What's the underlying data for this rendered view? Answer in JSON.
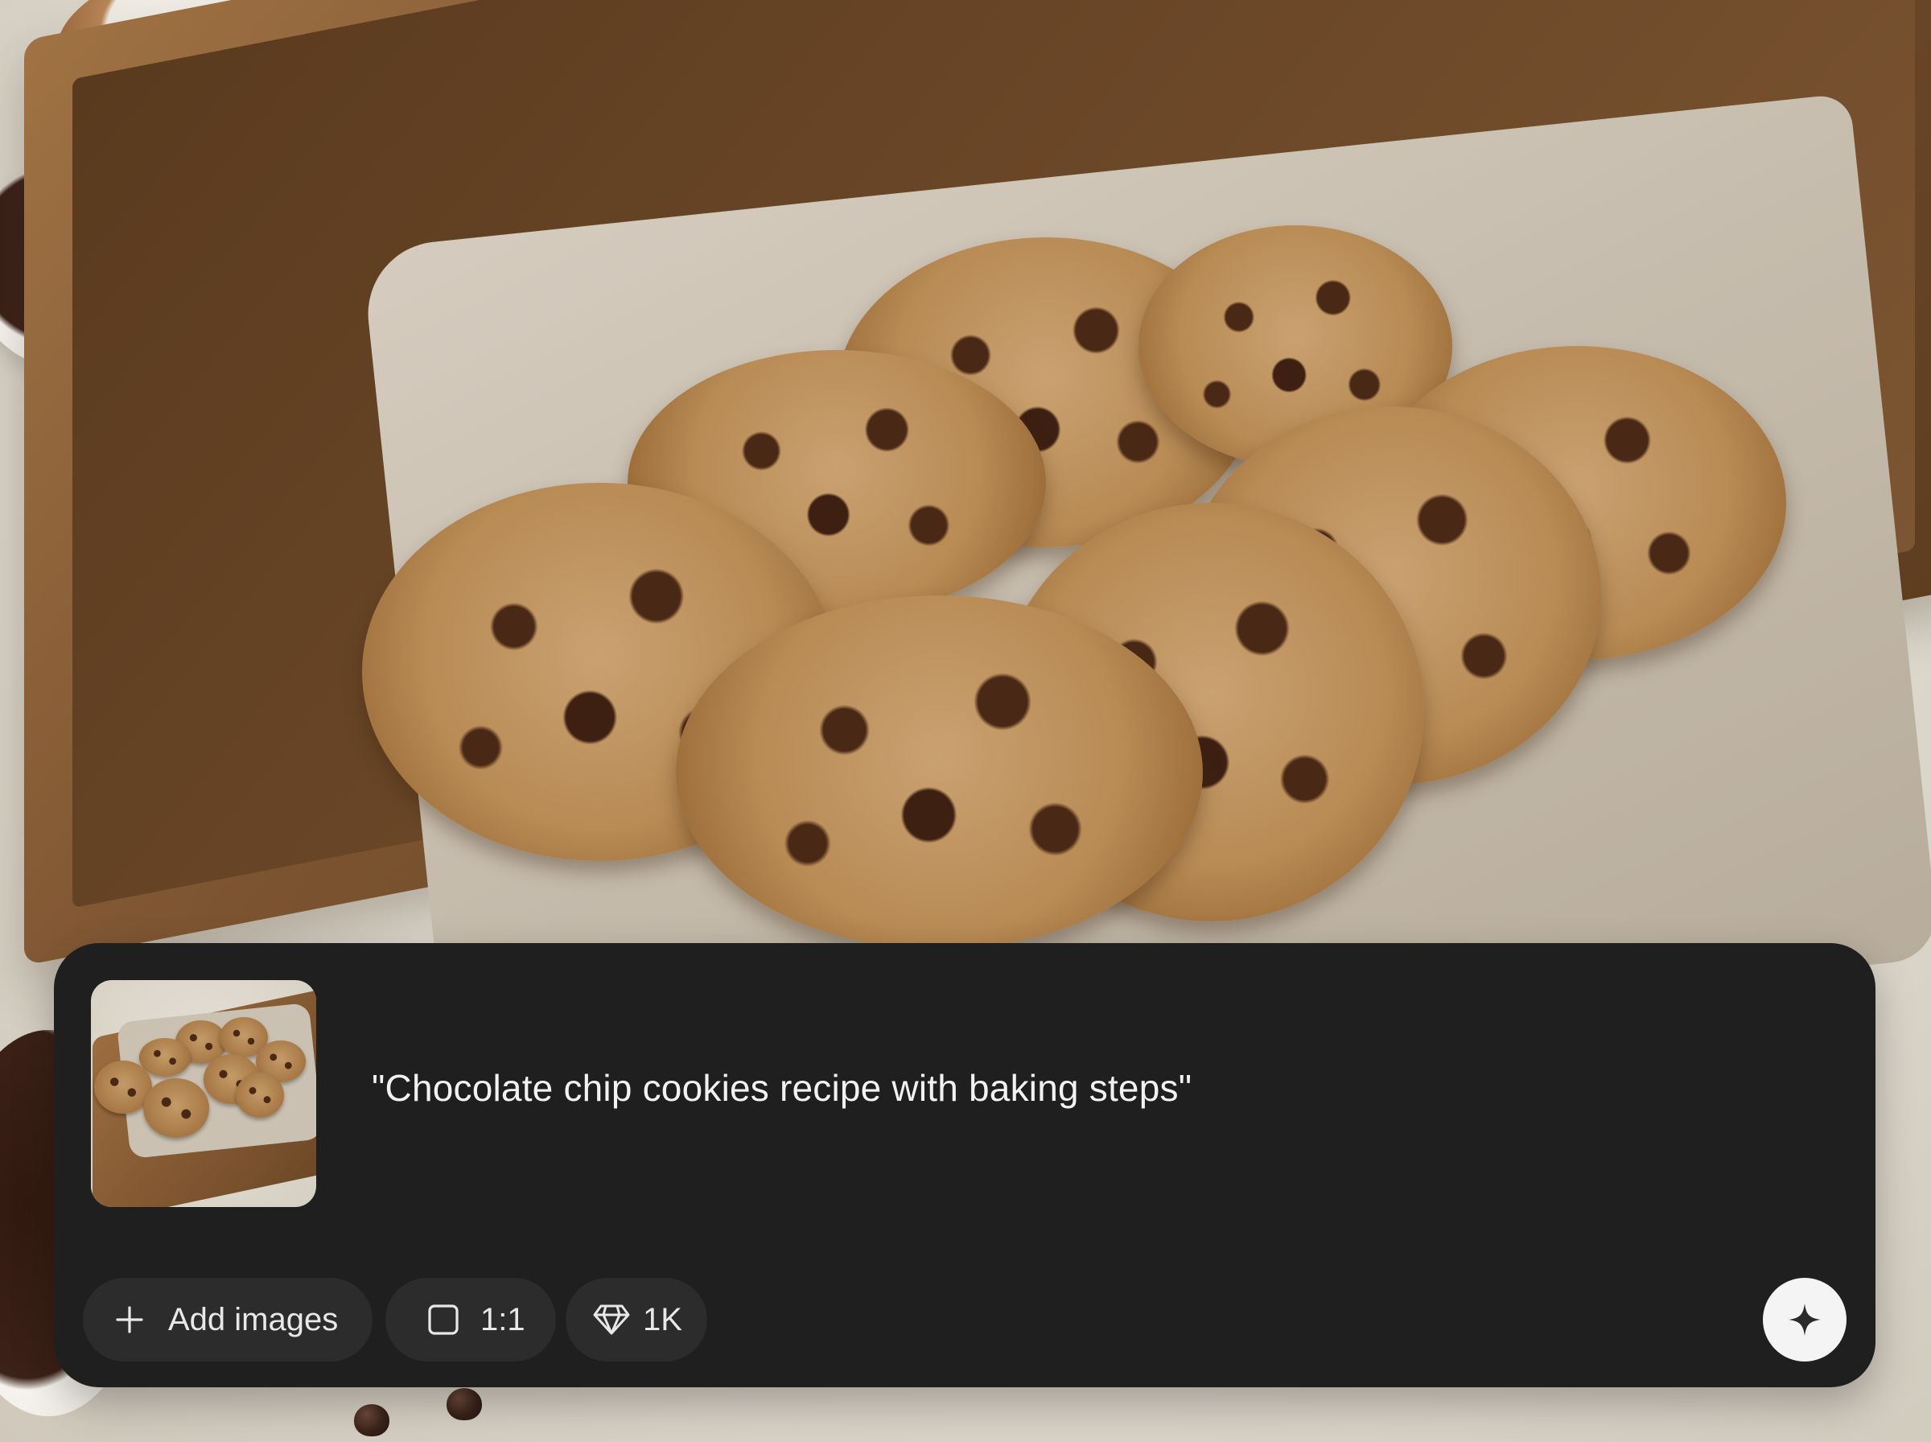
{
  "background": {
    "description_icon": "cookies-photo"
  },
  "prompt": {
    "text": "\"Chocolate chip cookies recipe with baking steps\"",
    "thumbnail_icon": "cookie-thumbnail-image"
  },
  "toolbar": {
    "add_images_label": "Add images",
    "add_images_icon": "plus-icon",
    "aspect_ratio_label": "1:1",
    "aspect_ratio_icon": "square-icon",
    "resolution_label": "1K",
    "resolution_icon": "diamond-icon",
    "generate_icon": "sparkle-icon"
  },
  "colors": {
    "panel_bg": "#1f1f1f",
    "chip_bg": "#2c2c2c",
    "text": "#f2f2f2",
    "generate_bg": "#f4f4f4"
  }
}
